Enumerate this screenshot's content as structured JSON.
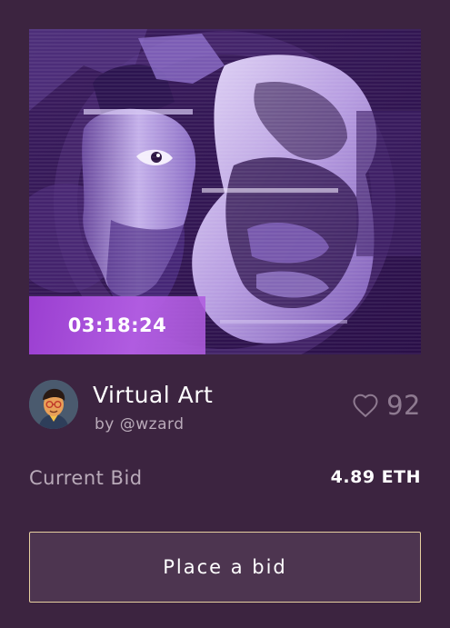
{
  "auction": {
    "timer": "03:18:24"
  },
  "nft": {
    "title": "Virtual Art",
    "creator": "by @wzard",
    "likes": "92",
    "like_icon": "heart-outline-icon"
  },
  "bid": {
    "label": "Current Bid",
    "value": "4.89 ETH",
    "button_label": "Place a bid"
  },
  "colors": {
    "background": "#3c2440",
    "button_border": "#e6cfa0",
    "timer_accent": "#9b3fd1"
  }
}
